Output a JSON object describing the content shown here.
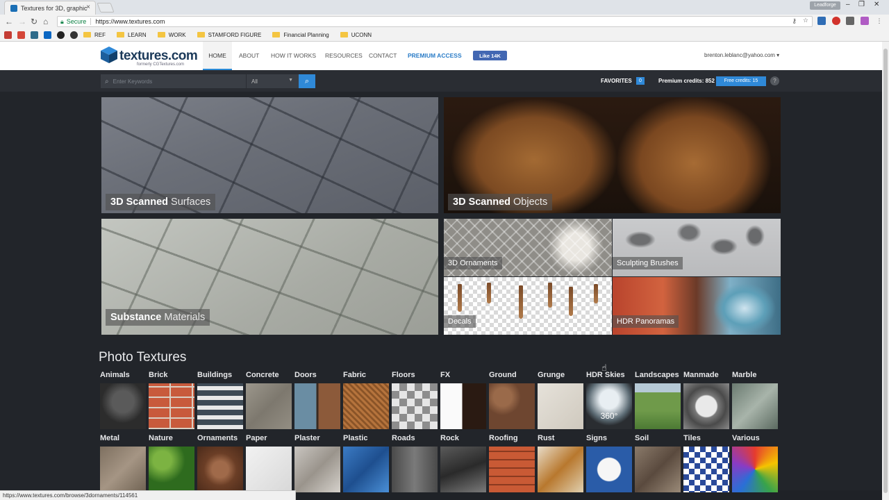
{
  "browser": {
    "tab_title": "Textures for 3D, graphic",
    "tab_close": "×",
    "profile": "Leadforge",
    "window_controls": [
      "–",
      "❐",
      "✕"
    ],
    "secure_label": "Secure",
    "url": "https://www.textures.com",
    "status_url": "https://www.textures.com/browse/3dornaments/114561"
  },
  "bookmarks": [
    {
      "label": "REF"
    },
    {
      "label": "LEARN"
    },
    {
      "label": "WORK"
    },
    {
      "label": "STAMFORD FIGURE"
    },
    {
      "label": "Financial Planning"
    },
    {
      "label": "UCONN"
    }
  ],
  "site": {
    "logo": "textures.com",
    "logo_sub": "formerly CGTextures.com",
    "nav": [
      {
        "label": "HOME"
      },
      {
        "label": "ABOUT"
      },
      {
        "label": "HOW IT WORKS"
      },
      {
        "label": "RESOURCES"
      },
      {
        "label": "CONTACT"
      },
      {
        "label": "PREMIUM ACCESS"
      }
    ],
    "fb_like": "Like 14K",
    "user": "brenton.leblanc@yahoo.com ▾"
  },
  "toolbar": {
    "search_placeholder": "Enter Keywords",
    "category_select": "All",
    "favorites_label": "FAVORITES",
    "favorites_count": "0",
    "premium_credits": "Premium credits: 852",
    "free_credits": "Free credits: 15",
    "help": "?"
  },
  "tiles": {
    "surfaces": {
      "bold": "3D Scanned",
      "light": "Surfaces"
    },
    "objects": {
      "bold": "3D Scanned",
      "light": "Objects"
    },
    "substance": {
      "bold": "Substance",
      "light": "Materials"
    },
    "ornaments": "3D Ornaments",
    "brushes": "Sculpting Brushes",
    "decals": "Decals",
    "hdr": "HDR Panoramas"
  },
  "photo_textures": {
    "title": "Photo Textures",
    "row1": [
      "Animals",
      "Brick",
      "Buildings",
      "Concrete",
      "Doors",
      "Fabric",
      "Floors",
      "FX",
      "Ground",
      "Grunge",
      "HDR Skies",
      "Landscapes",
      "Manmade",
      "Marble"
    ],
    "row2": [
      "Metal",
      "Nature",
      "Ornaments",
      "Paper",
      "Plaster",
      "Plastic",
      "Roads",
      "Rock",
      "Roofing",
      "Rust",
      "Signs",
      "Soil",
      "Tiles",
      "Various"
    ],
    "hdr_badge": "360°"
  }
}
